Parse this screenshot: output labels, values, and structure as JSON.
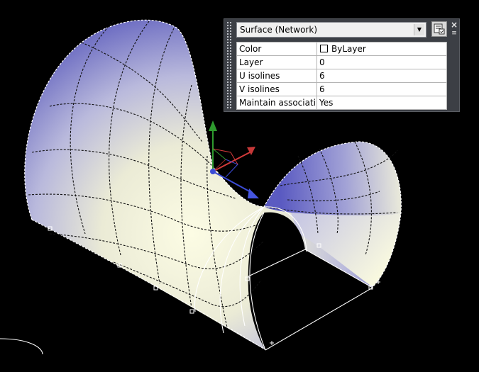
{
  "viewport": {
    "surface_colors": {
      "edge_blue": "#4a4ab8",
      "mid_lavender": "#b4b4de",
      "center_cream": "#fbfbe0",
      "isoline": "#000000",
      "wire": "#ffffff"
    },
    "ucs_axis_colors": {
      "x": "#d23a3a",
      "y": "#2e9a2e",
      "z": "#3b4bd6"
    }
  },
  "palette": {
    "object_type": "Surface (Network)",
    "close_label": "×",
    "menu_label": "≡",
    "properties": [
      {
        "name": "Color",
        "value": "ByLayer",
        "swatch": "#ffffff"
      },
      {
        "name": "Layer",
        "value": "0"
      },
      {
        "name": "U isolines",
        "value": "6"
      },
      {
        "name": "V isolines",
        "value": "6"
      },
      {
        "name": "Maintain associati...",
        "value": "Yes"
      }
    ]
  }
}
